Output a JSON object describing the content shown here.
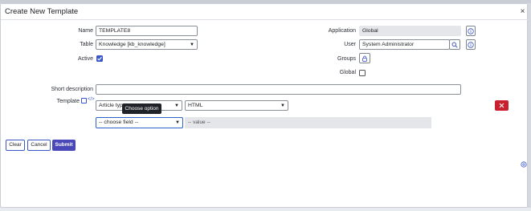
{
  "dialog": {
    "title": "Create New Template",
    "close_glyph": "×"
  },
  "form": {
    "name_label": "Name",
    "name_value": "TEMPLATE8",
    "table_label": "Table",
    "table_value": "Knowledge [kb_knowledge]",
    "active_label": "Active",
    "active_checked": true,
    "application_label": "Application",
    "application_value": "Global",
    "user_label": "User",
    "user_value": "System Administrator",
    "groups_label": "Groups",
    "global_label": "Global",
    "global_checked": false,
    "short_description_label": "Short description",
    "short_description_value": "",
    "template_label": "Template",
    "field_select_value": "Article typ",
    "field_value_select": "HTML",
    "choose_field_value": "-- choose field --",
    "value_placeholder": "-- value --",
    "tooltip": "Choose option"
  },
  "buttons": {
    "clear": "Clear",
    "cancel": "Cancel",
    "submit": "Submit"
  },
  "colors": {
    "primary": "#4a48b8",
    "danger": "#c8202e",
    "checkbox_on": "#3a55c8"
  },
  "icons": {
    "info": "info-icon",
    "search": "search-icon",
    "lock": "lock-icon",
    "close": "close-icon",
    "remove": "remove-icon",
    "help": "help-icon"
  }
}
